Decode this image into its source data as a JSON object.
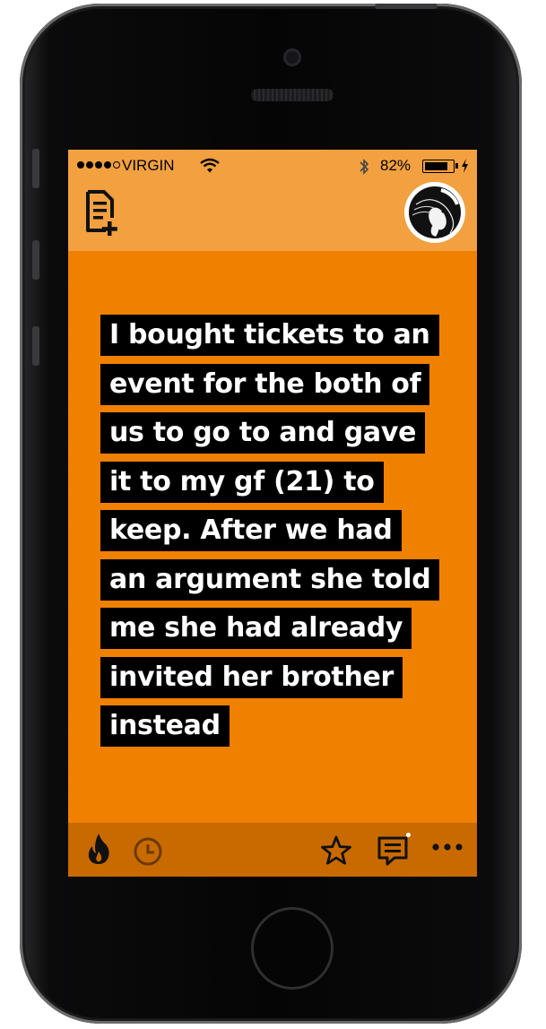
{
  "status_bar": {
    "carrier": "VIRGIN",
    "battery_percent": "82%",
    "battery_level": 0.82,
    "signal_bars_filled": 4,
    "signal_bars_total": 5
  },
  "header": {
    "new_post_icon": "compose-document-icon",
    "profile_icon": "koi-fish-avatar-icon"
  },
  "post": {
    "lines": [
      "I bought tickets to an",
      "event for the both of",
      "us to go to and gave",
      "it to my gf (21) to",
      "keep. After we had",
      "an argument she told",
      "me she had already",
      "invited her brother",
      "instead"
    ],
    "background_color": "#f08000"
  },
  "bottom_bar": {
    "icons": [
      "flame-icon",
      "clock-icon",
      "star-icon",
      "comments-icon",
      "more-icon"
    ],
    "has_new_comment_indicator": true
  },
  "colors": {
    "accent_light": "#f2a040",
    "accent": "#f08000",
    "accent_dark": "#c86a00"
  }
}
